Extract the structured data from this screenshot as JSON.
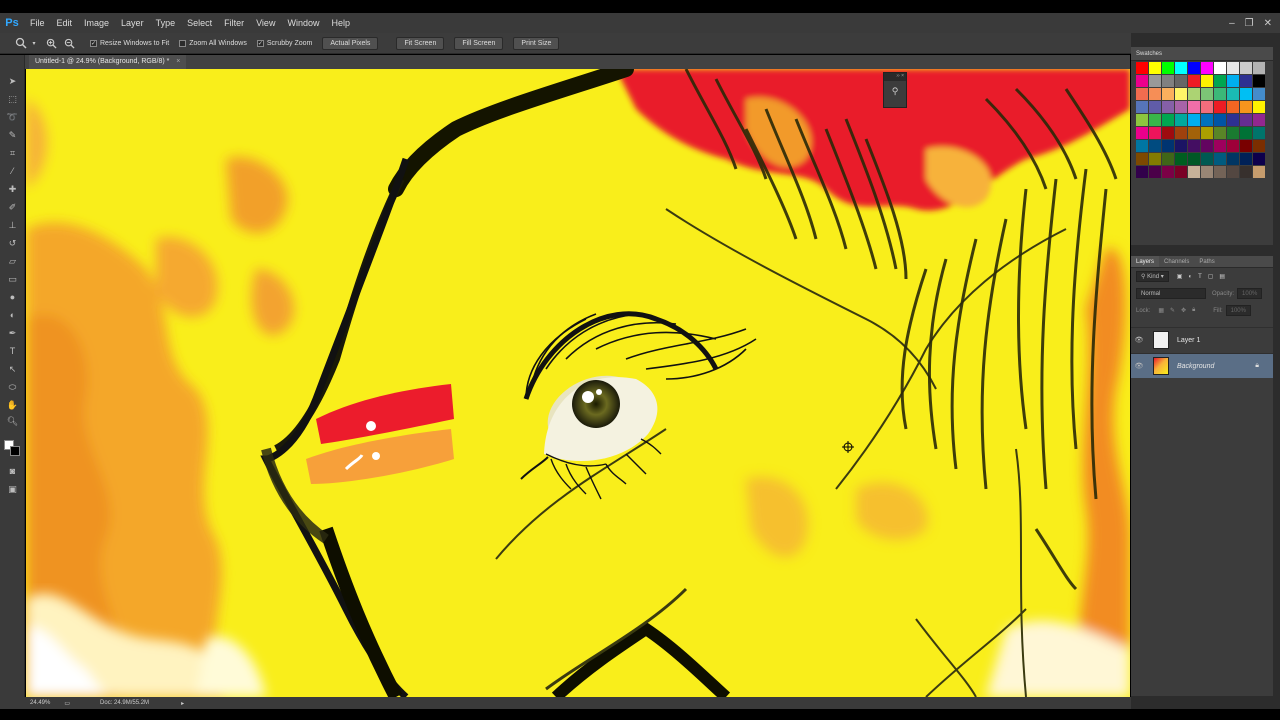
{
  "app": {
    "logo": "Ps"
  },
  "menu": [
    "File",
    "Edit",
    "Image",
    "Layer",
    "Type",
    "Select",
    "Filter",
    "View",
    "Window",
    "Help"
  ],
  "window_controls": {
    "minimize": "–",
    "restore": "❐",
    "close": "✕"
  },
  "options": {
    "resize_windows": "Resize Windows to Fit",
    "zoom_all_windows": "Zoom All Windows",
    "scrubby_zoom": "Scrubby Zoom",
    "actual_pixels": "Actual Pixels",
    "fit_screen": "Fit Screen",
    "fill_screen": "Fill Screen",
    "print_size": "Print Size"
  },
  "document": {
    "tab_title": "Untitled-1 @ 24.9% (Background, RGB/8) *",
    "tab_close": "×"
  },
  "status": {
    "zoom": "24.49%",
    "doc": "Doc: 24.9M/55.2M"
  },
  "panels": {
    "swatches_title": "Swatches",
    "layers_tabs": [
      "Layers",
      "Channels",
      "Paths"
    ],
    "kind_label": "Kind",
    "blend_mode": "Normal",
    "opacity_label": "Opacity:",
    "opacity_value": "100%",
    "lock_label": "Lock:",
    "fill_label": "Fill:",
    "fill_value": "100%"
  },
  "layers": [
    {
      "name": "Layer 1",
      "selected": false
    },
    {
      "name": "Background",
      "selected": true
    }
  ],
  "swatch_colors_row1": [
    "#ff0000",
    "#ffff00",
    "#00ff00",
    "#00ffff",
    "#0000ff",
    "#ff00ff",
    "#ffffff",
    "#e6e6e6",
    "#cccccc",
    "#b3b3b3"
  ],
  "swatch_colors_row2": [
    "#ec008c",
    "#999999",
    "#808080",
    "#666666",
    "#ed1c24",
    "#fff200",
    "#00a651",
    "#00aeef",
    "#2e3192",
    "#000000"
  ],
  "swatch_grid": [
    [
      "#f26c4f",
      "#f68e56",
      "#fbaf5d",
      "#fff568",
      "#acd373",
      "#7cc576",
      "#3bb878",
      "#1abbb4",
      "#00bff3",
      "#448ccb"
    ],
    [
      "#5674b9",
      "#605ca8",
      "#8560a8",
      "#a763a8",
      "#f06ea9",
      "#f26d7d",
      "#ed1c24",
      "#f26522",
      "#f7941d",
      "#fff200"
    ],
    [
      "#8dc63f",
      "#39b54a",
      "#00a651",
      "#00a99d",
      "#00aeef",
      "#0072bc",
      "#0054a6",
      "#2e3192",
      "#662d91",
      "#92278f"
    ],
    [
      "#ec008c",
      "#ed145b",
      "#9e0b0f",
      "#a0410d",
      "#a36209",
      "#aba000",
      "#598527",
      "#1a7b30",
      "#007236",
      "#00746b"
    ],
    [
      "#0076a3",
      "#004b80",
      "#003471",
      "#1b1464",
      "#440e62",
      "#630460",
      "#9e005d",
      "#9e0039",
      "#790000",
      "#7b2e00"
    ],
    [
      "#7d4900",
      "#827b00",
      "#406618",
      "#005e20",
      "#005826",
      "#005952",
      "#005b7f",
      "#003663",
      "#002157",
      "#0d004c"
    ],
    [
      "#32004b",
      "#4b0049",
      "#7b0046",
      "#7a0026",
      "#c7b299",
      "#998675",
      "#736357",
      "#534741",
      "#37302d",
      "#c69c6d"
    ]
  ]
}
